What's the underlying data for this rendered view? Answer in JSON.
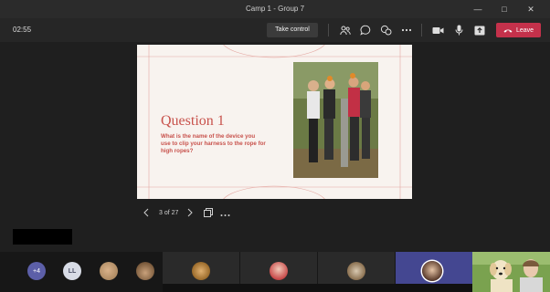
{
  "window": {
    "title": "Camp 1 - Group 7",
    "controls": [
      "minimize-icon",
      "maximize-icon",
      "close-icon"
    ]
  },
  "toolbar": {
    "timer": "02:55",
    "take_control_label": "Take control",
    "leave_label": "Leave",
    "icons": [
      "people-icon",
      "chat-icon",
      "reactions-icon",
      "more-icon",
      "camera-icon",
      "microphone-icon",
      "share-icon",
      "phone-icon"
    ],
    "leave_color": "#c4314b"
  },
  "slide": {
    "title": "Question 1",
    "question": "What is the name of the device you use to clip your harness to the rope for high ropes?",
    "accent_color": "#c8524c",
    "background": "#f8f3ef"
  },
  "slide_controls": {
    "page": "3 of 27",
    "icons": [
      "chevron-left-icon",
      "chevron-right-icon",
      "grid-view-icon",
      "more-icon"
    ]
  },
  "participants": {
    "overflow_count": "+4",
    "initials": "LL"
  }
}
